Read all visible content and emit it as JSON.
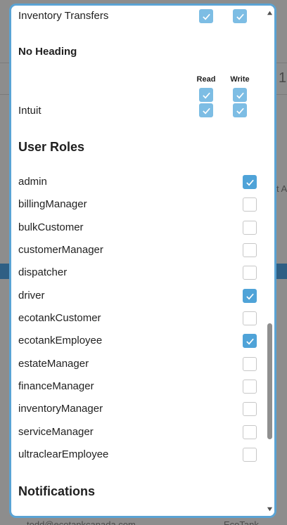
{
  "background": {
    "fragments": [
      {
        "text": "1"
      },
      {
        "text": "t A"
      },
      {
        "text": "todd@ecotankcanada.com"
      },
      {
        "text": "EcoTank"
      }
    ]
  },
  "modal": {
    "inventory_transfers": {
      "label": "Inventory Transfers"
    },
    "no_heading": {
      "title": "No Heading",
      "read_header": "Read",
      "write_header": "Write",
      "row_label": "Intuit"
    },
    "user_roles": {
      "title": "User Roles",
      "roles": [
        {
          "label": "admin",
          "checked": true
        },
        {
          "label": "billingManager",
          "checked": false
        },
        {
          "label": "bulkCustomer",
          "checked": false
        },
        {
          "label": "customerManager",
          "checked": false
        },
        {
          "label": "dispatcher",
          "checked": false
        },
        {
          "label": "driver",
          "checked": true
        },
        {
          "label": "ecotankCustomer",
          "checked": false
        },
        {
          "label": "ecotankEmployee",
          "checked": true
        },
        {
          "label": "estateManager",
          "checked": false
        },
        {
          "label": "financeManager",
          "checked": false
        },
        {
          "label": "inventoryManager",
          "checked": false
        },
        {
          "label": "serviceManager",
          "checked": false
        },
        {
          "label": "ultraclearEmployee",
          "checked": false
        }
      ]
    },
    "notifications": {
      "title": "Notifications"
    }
  },
  "colors": {
    "accent": "#4fa3d8",
    "modal_border": "#5aa3d4",
    "overlay": "#8d8d8d"
  }
}
